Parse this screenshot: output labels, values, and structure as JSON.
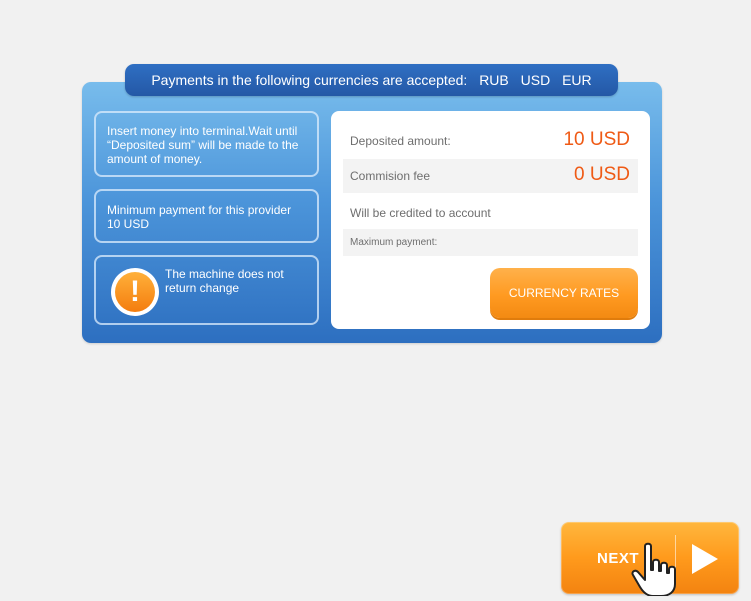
{
  "banner": {
    "text": "Payments in the following currencies are accepted:",
    "currencies": [
      "RUB",
      "USD",
      "EUR"
    ]
  },
  "info": {
    "insert_money": "Insert money into terminal.Wait until “Deposited sum” will be made to the amount of money.",
    "minimum_payment": "Minimum payment for this provider 10 USD",
    "no_change": "The machine does not return change",
    "warning_icon": "exclamation-warning-icon",
    "warning_glyph": "!"
  },
  "payment": {
    "deposited_label": "Deposited amount:",
    "deposited_value": "10 USD",
    "fee_label": "Commision fee",
    "fee_value": "0 USD",
    "credited_label": "Will be credited to account",
    "max_label": "Maximum payment:"
  },
  "buttons": {
    "currency_rates": "CURRENCY RATES",
    "next": "NEXT"
  },
  "colors": {
    "accent_orange": "#ff9a1c",
    "panel_blue": "#2d6fc0",
    "value_orange": "#ef5a15"
  }
}
